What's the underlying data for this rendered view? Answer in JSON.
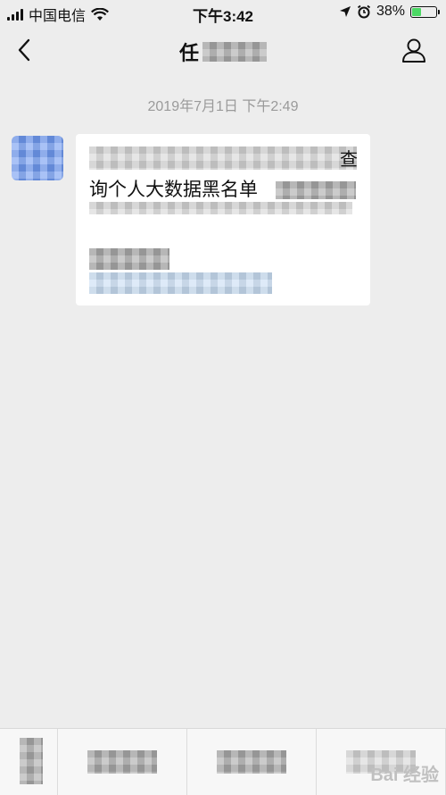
{
  "status_bar": {
    "carrier": "中国电信",
    "time": "下午3:42",
    "battery_percent": "38%",
    "battery_level": 0.38,
    "battery_color": "#4cd964"
  },
  "nav": {
    "title_visible": "任",
    "back_icon": "chevron-left-icon",
    "profile_icon": "person-icon"
  },
  "chat": {
    "timestamp": "2019年7月1日 下午2:49",
    "message": {
      "line1_end": "查",
      "line2": "询个人大数据黑名单"
    }
  },
  "bottom_menu": {
    "keyboard_icon": "keyboard-icon"
  },
  "watermark": "Bai 经验"
}
